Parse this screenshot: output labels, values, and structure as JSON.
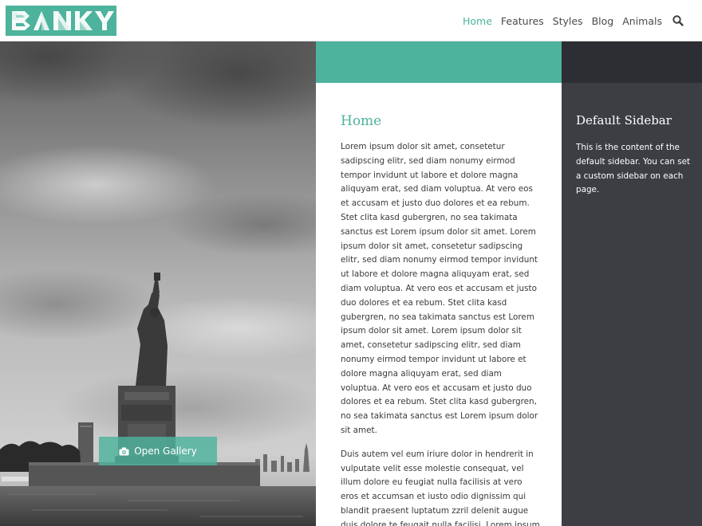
{
  "header": {
    "logo_text": "BANKY",
    "nav": [
      {
        "label": "Home",
        "active": true
      },
      {
        "label": "Features",
        "active": false
      },
      {
        "label": "Styles",
        "active": false
      },
      {
        "label": "Blog",
        "active": false
      },
      {
        "label": "Animals",
        "active": false
      }
    ],
    "search_icon": "search-icon"
  },
  "hero": {
    "gallery_button_label": "Open Gallery",
    "gallery_icon": "camera-icon"
  },
  "main": {
    "title": "Home",
    "paragraphs": [
      "Lorem ipsum dolor sit amet, consetetur sadipscing elitr, sed diam nonumy eirmod tempor invidunt ut labore et dolore magna aliquyam erat, sed diam voluptua. At vero eos et accusam et justo duo dolores et ea rebum. Stet clita kasd gubergren, no sea takimata sanctus est Lorem ipsum dolor sit amet. Lorem ipsum dolor sit amet, consetetur sadipscing elitr, sed diam nonumy eirmod tempor invidunt ut labore et dolore magna aliquyam erat, sed diam voluptua. At vero eos et accusam et justo duo dolores et ea rebum. Stet clita kasd gubergren, no sea takimata sanctus est Lorem ipsum dolor sit amet. Lorem ipsum dolor sit amet, consetetur sadipscing elitr, sed diam nonumy eirmod tempor invidunt ut labore et dolore magna aliquyam erat, sed diam voluptua. At vero eos et accusam et justo duo dolores et ea rebum. Stet clita kasd gubergren, no sea takimata sanctus est Lorem ipsum dolor sit amet.",
      "Duis autem vel eum iriure dolor in hendrerit in vulputate velit esse molestie consequat, vel illum dolore eu feugiat nulla facilisis at vero eros et accumsan et iusto odio dignissim qui blandit praesent luptatum zzril delenit augue duis dolore te feugait nulla facilisi. Lorem ipsum"
    ]
  },
  "sidebar": {
    "title": "Default Sidebar",
    "text": "This is the content of the default sidebar. You can set a custom sidebar on each page."
  },
  "colors": {
    "accent": "#4db39c",
    "sidebar_bg": "#3d3e44",
    "sidebar_band": "#2d2e33"
  }
}
